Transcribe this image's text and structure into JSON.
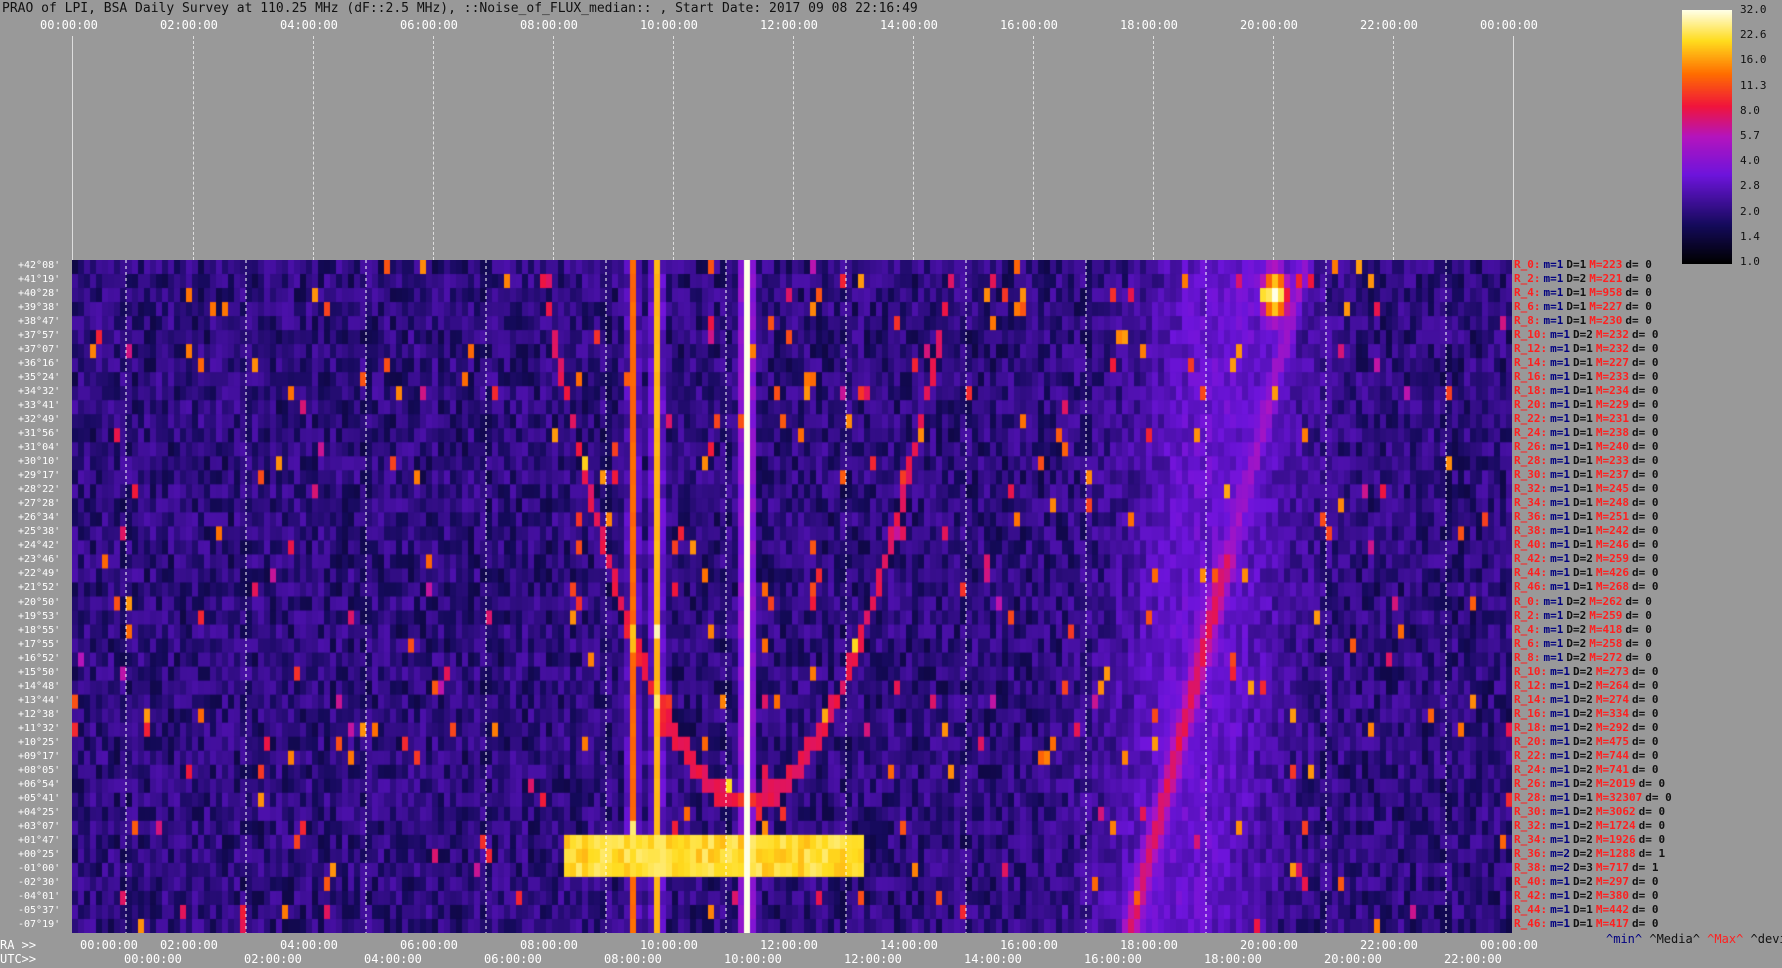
{
  "title": "PRAO of LPI, BSA Daily Survey at 110.25 MHz (dF::2.5 MHz), ::Noise_of_FLUX_median:: , Start Date: 2017 09 08 22:16:49",
  "top_ticks": [
    "00:00:00",
    "02:00:00",
    "04:00:00",
    "06:00:00",
    "08:00:00",
    "10:00:00",
    "12:00:00",
    "14:00:00",
    "16:00:00",
    "18:00:00",
    "20:00:00",
    "22:00:00",
    "00:00:00"
  ],
  "ra_ticks": [
    "00:00:00",
    "02:00:00",
    "04:00:00",
    "06:00:00",
    "08:00:00",
    "10:00:00",
    "12:00:00",
    "14:00:00",
    "16:00:00",
    "18:00:00",
    "20:00:00",
    "22:00:00",
    "00:00:00"
  ],
  "utc_ticks": [
    "00:00:00",
    "02:00:00",
    "04:00:00",
    "06:00:00",
    "08:00:00",
    "10:00:00",
    "12:00:00",
    "14:00:00",
    "16:00:00",
    "18:00:00",
    "20:00:00",
    "22:00:00"
  ],
  "bottom": {
    "ra_label": "RA >>",
    "utc_label": "UTC>>"
  },
  "legend_labels": {
    "min": "^min^",
    "media": "^Media^",
    "max": "^Max^",
    "devia": "^devia^"
  },
  "colors": {
    "background": "#999999",
    "max_label": "#ff2020",
    "min_label": "#000080"
  },
  "colorbar": {
    "ticks": [
      "32.0",
      "22.6",
      "16.0",
      "11.3",
      "8.0",
      "5.7",
      "4.0",
      "2.8",
      "2.0",
      "1.4",
      "1.0"
    ]
  },
  "dec_labels": [
    "+42°08'",
    "+41°19'",
    "+40°28'",
    "+39°38'",
    "+38°47'",
    "+37°57'",
    "+37°07'",
    "+36°16'",
    "+35°24'",
    "+34°32'",
    "+33°41'",
    "+32°49'",
    "+31°56'",
    "+31°04'",
    "+30°10'",
    "+29°17'",
    "+28°22'",
    "+27°28'",
    "+26°34'",
    "+25°38'",
    "+24°42'",
    "+23°46'",
    "+22°49'",
    "+21°52'",
    "+20°50'",
    "+19°53'",
    "+18°55'",
    "+17°55'",
    "+16°52'",
    "+15°50'",
    "+14°48'",
    "+13°44'",
    "+12°38'",
    "+11°32'",
    "+10°25'",
    "+09°17'",
    "+08°05'",
    "+06°54'",
    "+05°41'",
    "+04°25'",
    "+03°07'",
    "+01°47'",
    "+00°25'",
    "-01°00'",
    "-02°30'",
    "-04°01'",
    "-05°37'",
    "-07°19'"
  ],
  "row_stats": [
    {
      "r": "R_0:",
      "m": "m=1",
      "d": "D=1",
      "M": "M=223",
      "dv": "d= 0"
    },
    {
      "r": "R_2:",
      "m": "m=1",
      "d": "D=2",
      "M": "M=221",
      "dv": "d= 0"
    },
    {
      "r": "R_4:",
      "m": "m=1",
      "d": "D=1",
      "M": "M=958",
      "dv": "d= 0"
    },
    {
      "r": "R_6:",
      "m": "m=1",
      "d": "D=1",
      "M": "M=227",
      "dv": "d= 0"
    },
    {
      "r": "R_8:",
      "m": "m=1",
      "d": "D=1",
      "M": "M=230",
      "dv": "d= 0"
    },
    {
      "r": "R_10:",
      "m": "m=1",
      "d": "D=2",
      "M": "M=232",
      "dv": "d= 0"
    },
    {
      "r": "R_12:",
      "m": "m=1",
      "d": "D=1",
      "M": "M=232",
      "dv": "d= 0"
    },
    {
      "r": "R_14:",
      "m": "m=1",
      "d": "D=1",
      "M": "M=227",
      "dv": "d= 0"
    },
    {
      "r": "R_16:",
      "m": "m=1",
      "d": "D=1",
      "M": "M=233",
      "dv": "d= 0"
    },
    {
      "r": "R_18:",
      "m": "m=1",
      "d": "D=1",
      "M": "M=234",
      "dv": "d= 0"
    },
    {
      "r": "R_20:",
      "m": "m=1",
      "d": "D=1",
      "M": "M=229",
      "dv": "d= 0"
    },
    {
      "r": "R_22:",
      "m": "m=1",
      "d": "D=1",
      "M": "M=231",
      "dv": "d= 0"
    },
    {
      "r": "R_24:",
      "m": "m=1",
      "d": "D=1",
      "M": "M=238",
      "dv": "d= 0"
    },
    {
      "r": "R_26:",
      "m": "m=1",
      "d": "D=1",
      "M": "M=240",
      "dv": "d= 0"
    },
    {
      "r": "R_28:",
      "m": "m=1",
      "d": "D=1",
      "M": "M=233",
      "dv": "d= 0"
    },
    {
      "r": "R_30:",
      "m": "m=1",
      "d": "D=1",
      "M": "M=237",
      "dv": "d= 0"
    },
    {
      "r": "R_32:",
      "m": "m=1",
      "d": "D=1",
      "M": "M=245",
      "dv": "d= 0"
    },
    {
      "r": "R_34:",
      "m": "m=1",
      "d": "D=1",
      "M": "M=248",
      "dv": "d= 0"
    },
    {
      "r": "R_36:",
      "m": "m=1",
      "d": "D=1",
      "M": "M=251",
      "dv": "d= 0"
    },
    {
      "r": "R_38:",
      "m": "m=1",
      "d": "D=1",
      "M": "M=242",
      "dv": "d= 0"
    },
    {
      "r": "R_40:",
      "m": "m=1",
      "d": "D=1",
      "M": "M=246",
      "dv": "d= 0"
    },
    {
      "r": "R_42:",
      "m": "m=1",
      "d": "D=2",
      "M": "M=259",
      "dv": "d= 0"
    },
    {
      "r": "R_44:",
      "m": "m=1",
      "d": "D=1",
      "M": "M=426",
      "dv": "d= 0"
    },
    {
      "r": "R_46:",
      "m": "m=1",
      "d": "D=1",
      "M": "M=268",
      "dv": "d= 0"
    },
    {
      "r": "R_0:",
      "m": "m=1",
      "d": "D=2",
      "M": "M=262",
      "dv": "d= 0"
    },
    {
      "r": "R_2:",
      "m": "m=1",
      "d": "D=2",
      "M": "M=259",
      "dv": "d= 0"
    },
    {
      "r": "R_4:",
      "m": "m=1",
      "d": "D=2",
      "M": "M=418",
      "dv": "d= 0"
    },
    {
      "r": "R_6:",
      "m": "m=1",
      "d": "D=2",
      "M": "M=258",
      "dv": "d= 0"
    },
    {
      "r": "R_8:",
      "m": "m=1",
      "d": "D=2",
      "M": "M=272",
      "dv": "d= 0"
    },
    {
      "r": "R_10:",
      "m": "m=1",
      "d": "D=2",
      "M": "M=273",
      "dv": "d= 0"
    },
    {
      "r": "R_12:",
      "m": "m=1",
      "d": "D=2",
      "M": "M=264",
      "dv": "d= 0"
    },
    {
      "r": "R_14:",
      "m": "m=1",
      "d": "D=2",
      "M": "M=274",
      "dv": "d= 0"
    },
    {
      "r": "R_16:",
      "m": "m=1",
      "d": "D=2",
      "M": "M=334",
      "dv": "d= 0"
    },
    {
      "r": "R_18:",
      "m": "m=1",
      "d": "D=2",
      "M": "M=292",
      "dv": "d= 0"
    },
    {
      "r": "R_20:",
      "m": "m=1",
      "d": "D=2",
      "M": "M=475",
      "dv": "d= 0"
    },
    {
      "r": "R_22:",
      "m": "m=1",
      "d": "D=2",
      "M": "M=744",
      "dv": "d= 0"
    },
    {
      "r": "R_24:",
      "m": "m=1",
      "d": "D=2",
      "M": "M=741",
      "dv": "d= 0"
    },
    {
      "r": "R_26:",
      "m": "m=1",
      "d": "D=2",
      "M": "M=2019",
      "dv": "d= 0"
    },
    {
      "r": "R_28:",
      "m": "m=1",
      "d": "D=1",
      "M": "M=32307",
      "dv": "d= 0"
    },
    {
      "r": "R_30:",
      "m": "m=1",
      "d": "D=2",
      "M": "M=3062",
      "dv": "d= 0"
    },
    {
      "r": "R_32:",
      "m": "m=1",
      "d": "D=2",
      "M": "M=1724",
      "dv": "d= 0"
    },
    {
      "r": "R_34:",
      "m": "m=1",
      "d": "D=2",
      "M": "M=1926",
      "dv": "d= 0"
    },
    {
      "r": "R_36:",
      "m": "m=2",
      "d": "D=2",
      "M": "M=1288",
      "dv": "d= 1"
    },
    {
      "r": "R_38:",
      "m": "m=2",
      "d": "D=3",
      "M": "M=717",
      "dv": "d= 1"
    },
    {
      "r": "R_40:",
      "m": "m=1",
      "d": "D=2",
      "M": "M=297",
      "dv": "d= 0"
    },
    {
      "r": "R_42:",
      "m": "m=1",
      "d": "D=2",
      "M": "M=380",
      "dv": "d= 0"
    },
    {
      "r": "R_44:",
      "m": "m=1",
      "d": "D=1",
      "M": "M=442",
      "dv": "d= 0"
    },
    {
      "r": "R_46:",
      "m": "m=1",
      "d": "D=1",
      "M": "M=417",
      "dv": "d= 0"
    }
  ],
  "chart_data": {
    "type": "heatmap",
    "title": "PRAO of LPI, BSA Daily Survey at 110.25 MHz (dF::2.5 MHz), ::Noise_of_FLUX_median:: , Start Date: 2017 09 08 22:16:49",
    "x_range": [
      "00:00:00",
      "24:00:00"
    ],
    "x_tick_labels": [
      "00:00:00",
      "02:00:00",
      "04:00:00",
      "06:00:00",
      "08:00:00",
      "10:00:00",
      "12:00:00",
      "14:00:00",
      "16:00:00",
      "18:00:00",
      "20:00:00",
      "22:00:00",
      "00:00:00"
    ],
    "colorbar_range": [
      1.0,
      32.0
    ],
    "colorbar_scale": "log",
    "colorbar_ticks": [
      32.0,
      22.6,
      16.0,
      11.3,
      8.0,
      5.7,
      4.0,
      2.8,
      2.0,
      1.4,
      1.0
    ],
    "features": [
      {
        "type": "vertical_band",
        "ra_hours": 11.2,
        "intensity": 32.0
      },
      {
        "type": "vertical_band",
        "ra_hours": 9.7,
        "intensity": 16.0
      },
      {
        "type": "vertical_band",
        "ra_hours": 9.3,
        "intensity": 11.0
      },
      {
        "type": "horizontal_band",
        "ra_start_hours": 8.2,
        "ra_end_hours": 13.2,
        "dec_rows": [
          41,
          43
        ],
        "intensity": 22.6
      },
      {
        "type": "diagonal_band",
        "ra_start_hours": 17.6,
        "ra_end_hours": 20.5,
        "intensity": 8.0
      },
      {
        "type": "point_source",
        "ra_hours": 20.0,
        "dec_row": 2,
        "intensity": 32.0
      }
    ]
  }
}
